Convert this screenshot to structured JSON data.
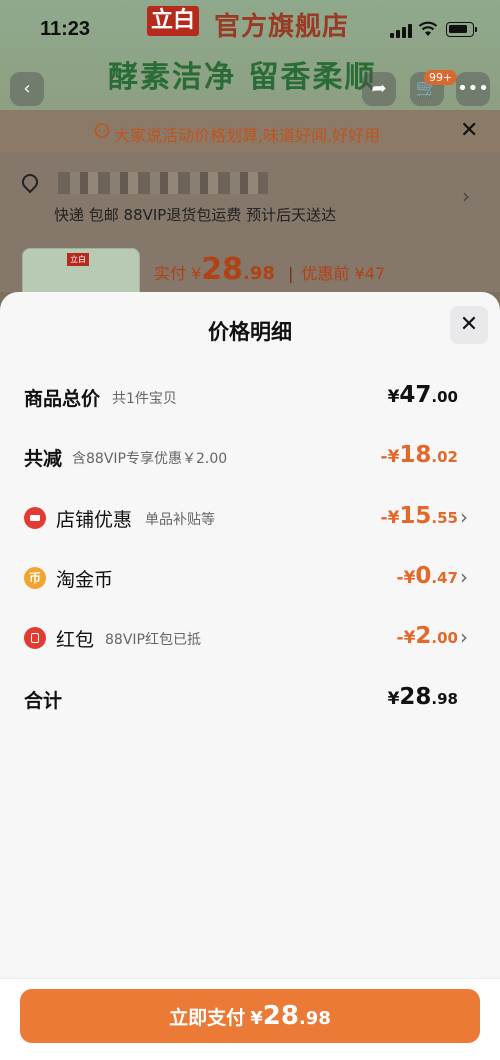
{
  "status_bar": {
    "time": "11:23"
  },
  "banner": {
    "logo": "立白",
    "store_name": "官方旗舰店",
    "slogan": "酵素洁净  留香柔顺",
    "cart_badge": "99+"
  },
  "notice": {
    "text": "大家说活动价格划算,味道好闻,好好用"
  },
  "order": {
    "shipping": "快递 包邮 88VIP退货包运费 预计后天送达",
    "thumb_tag": "立白",
    "pay_label": "实付",
    "pay_currency": "¥",
    "pay_int": "28",
    "pay_dec": ".98",
    "before_label": "优惠前 ¥47"
  },
  "sheet": {
    "title": "价格明细",
    "rows": [
      {
        "label": "商品总价",
        "sub": "共1件宝贝",
        "cur": "¥",
        "int": "47",
        "dec": ".00"
      },
      {
        "label": "共减",
        "sub": "含88VIP专享优惠￥2.00",
        "cur": "-¥",
        "int": "18",
        "dec": ".02"
      },
      {
        "label": "店铺优惠",
        "sub": "单品补贴等",
        "cur": "-¥",
        "int": "15",
        "dec": ".55"
      },
      {
        "label": "淘金币",
        "sub": "",
        "cur": "-¥",
        "int": "0",
        "dec": ".47"
      },
      {
        "label": "红包",
        "sub": "88VIP红包已抵",
        "cur": "-¥",
        "int": "2",
        "dec": ".00"
      },
      {
        "label": "合计",
        "sub": "",
        "cur": "¥",
        "int": "28",
        "dec": ".98"
      }
    ]
  },
  "footer": {
    "pay_label": "立即支付",
    "cur": "¥",
    "int": "28",
    "dec": ".98"
  },
  "colors": {
    "accent": "#ea7a35",
    "discount": "#e4682a",
    "icon_red": "#e23b32",
    "icon_gold": "#f1a530"
  }
}
